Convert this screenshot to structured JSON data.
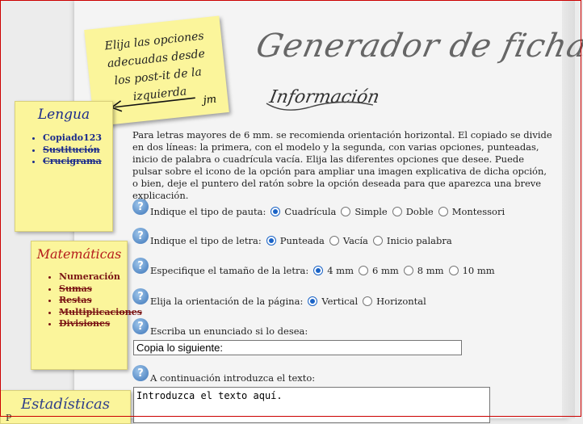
{
  "header": {
    "title": "Generador de fichas",
    "subtitle": "Información"
  },
  "postit": {
    "text": "Elija las opciones adecuadas desde los post-it de la izquierda",
    "signature": "jm"
  },
  "intro": "Para letras mayores de 6 mm. se recomienda orientación horizontal. El copiado se divide en dos líneas: la primera, con el modelo y la segunda, con varias opciones, punteadas, inicio de palabra o cuadrícula vacía. Elija las diferentes opciones que desee. Puede pulsar sobre el icono de la opción para ampliar una imagen explicativa de dicha opción, o bien, deje el puntero del ratón sobre la opción deseada para que aparezca una breve explicación.",
  "questions": {
    "pauta": {
      "label": "Indique el tipo de pauta:",
      "options": [
        "Cuadrícula",
        "Simple",
        "Doble",
        "Montessori"
      ],
      "selected": "Cuadrícula"
    },
    "letra": {
      "label": "Indique el tipo de letra:",
      "options": [
        "Punteada",
        "Vacía",
        "Inicio palabra"
      ],
      "selected": "Punteada"
    },
    "tamano": {
      "label": "Especifique el tamaño de la letra:",
      "options": [
        "4 mm",
        "6 mm",
        "8 mm",
        "10 mm"
      ],
      "selected": "4 mm"
    },
    "orientacion": {
      "label": "Elija la orientación de la página:",
      "options": [
        "Vertical",
        "Horizontal"
      ],
      "selected": "Vertical"
    },
    "enunciado": {
      "label": "Escriba un enunciado si lo desea:",
      "value": "Copia lo siguiente:"
    },
    "texto": {
      "label": "A continuación introduzca el texto:",
      "value": "Introduzca el texto aquí."
    }
  },
  "sidebar": {
    "lengua": {
      "title": "Lengua",
      "items": [
        {
          "label": "Copiado123",
          "struck": false
        },
        {
          "label": "Sustitución",
          "struck": true
        },
        {
          "label": "Crucigrama",
          "struck": true
        }
      ]
    },
    "matematicas": {
      "title": "Matemáticas",
      "items": [
        {
          "label": "Numeración",
          "struck": false
        },
        {
          "label": "Sumas",
          "struck": true
        },
        {
          "label": "Restas",
          "struck": true
        },
        {
          "label": "Multiplicaciones",
          "struck": true
        },
        {
          "label": "Divisiones",
          "struck": true
        }
      ]
    },
    "estadisticas": {
      "title": "Estadísticas",
      "sub": "P"
    }
  },
  "colors": {
    "lengua": "#1b2b8c",
    "matematicas": "#b51c1c",
    "postit": "#fbf59b",
    "radio": "#1a63c6"
  }
}
